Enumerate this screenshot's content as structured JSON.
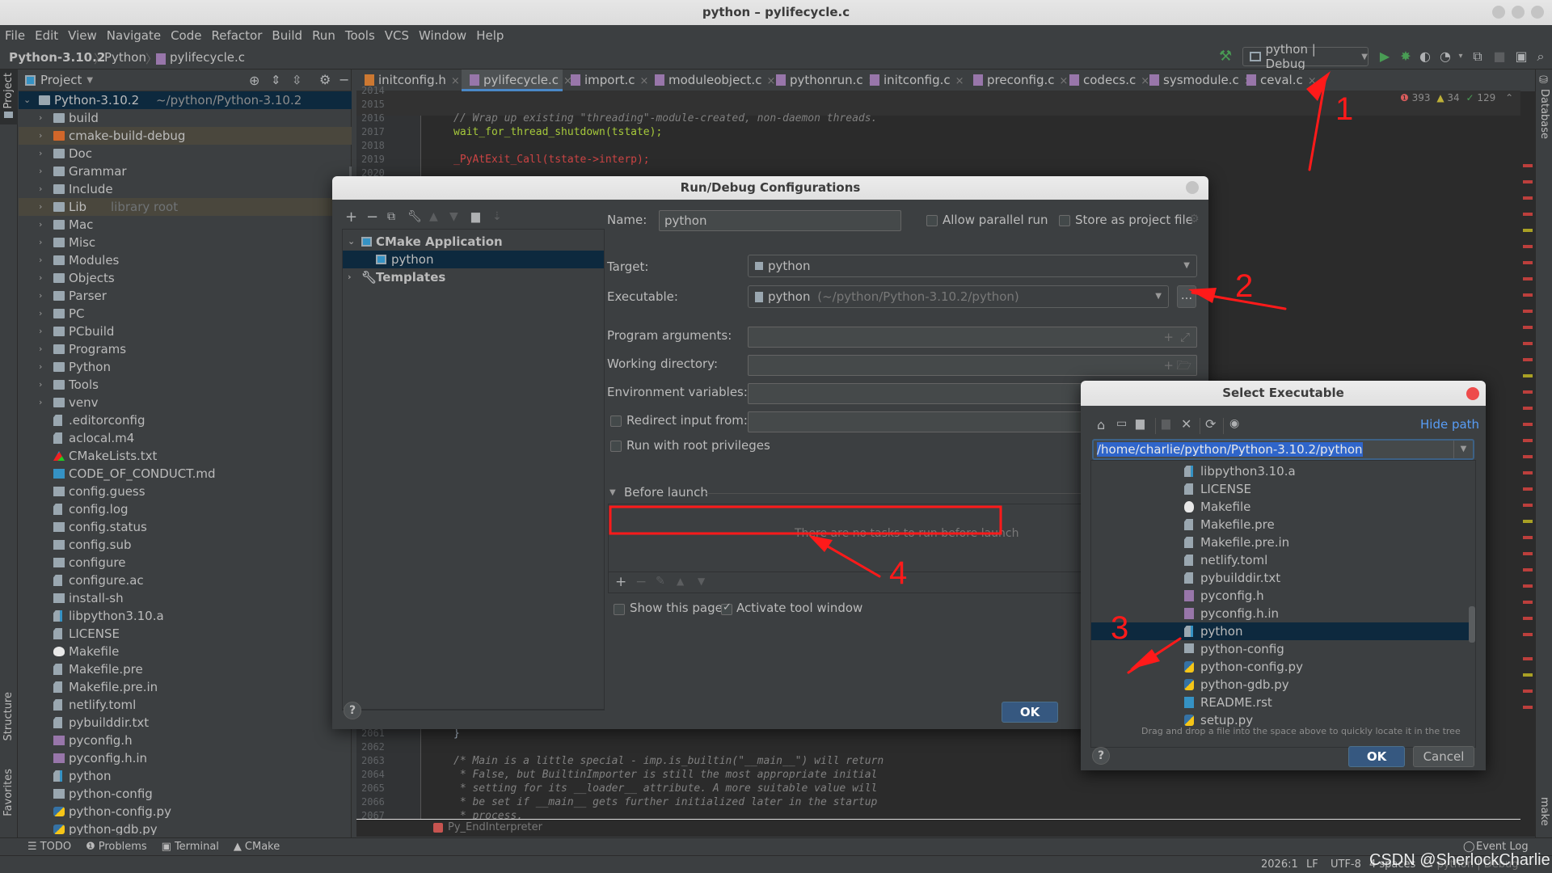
{
  "window": {
    "title": "python – pylifecycle.c"
  },
  "menu": [
    "File",
    "Edit",
    "View",
    "Navigate",
    "Code",
    "Refactor",
    "Build",
    "Run",
    "Tools",
    "VCS",
    "Window",
    "Help"
  ],
  "breadcrumb": [
    "Python-3.10.2",
    "Python",
    "pylifecycle.c"
  ],
  "run_config": {
    "label": "python | Debug"
  },
  "left_stripe": {
    "project": "Project",
    "structure": "Structure",
    "favorites": "Favorites"
  },
  "right_stripe": {
    "database": "Database",
    "make": "make"
  },
  "project_panel": {
    "title": "Project",
    "root": {
      "name": "Python-3.10.2",
      "path": "~/python/Python-3.10.2"
    },
    "items": [
      {
        "name": "build",
        "type": "folder"
      },
      {
        "name": "cmake-build-debug",
        "type": "folder-excluded"
      },
      {
        "name": "Doc",
        "type": "folder"
      },
      {
        "name": "Grammar",
        "type": "folder"
      },
      {
        "name": "Include",
        "type": "folder"
      },
      {
        "name": "Lib",
        "type": "folder",
        "note": "library root"
      },
      {
        "name": "Mac",
        "type": "folder"
      },
      {
        "name": "Misc",
        "type": "folder"
      },
      {
        "name": "Modules",
        "type": "folder"
      },
      {
        "name": "Objects",
        "type": "folder"
      },
      {
        "name": "Parser",
        "type": "folder"
      },
      {
        "name": "PC",
        "type": "folder"
      },
      {
        "name": "PCbuild",
        "type": "folder"
      },
      {
        "name": "Programs",
        "type": "folder"
      },
      {
        "name": "Python",
        "type": "folder"
      },
      {
        "name": "Tools",
        "type": "folder"
      },
      {
        "name": "venv",
        "type": "folder"
      },
      {
        "name": ".editorconfig",
        "type": "file"
      },
      {
        "name": "aclocal.m4",
        "type": "file"
      },
      {
        "name": "CMakeLists.txt",
        "type": "cmake"
      },
      {
        "name": "CODE_OF_CONDUCT.md",
        "type": "md"
      },
      {
        "name": "config.guess",
        "type": "exec"
      },
      {
        "name": "config.log",
        "type": "file"
      },
      {
        "name": "config.status",
        "type": "exec"
      },
      {
        "name": "config.sub",
        "type": "exec"
      },
      {
        "name": "configure",
        "type": "exec"
      },
      {
        "name": "configure.ac",
        "type": "file"
      },
      {
        "name": "install-sh",
        "type": "exec"
      },
      {
        "name": "libpython3.10.a",
        "type": "unknown"
      },
      {
        "name": "LICENSE",
        "type": "file"
      },
      {
        "name": "Makefile",
        "type": "gnu"
      },
      {
        "name": "Makefile.pre",
        "type": "file"
      },
      {
        "name": "Makefile.pre.in",
        "type": "file"
      },
      {
        "name": "netlify.toml",
        "type": "file"
      },
      {
        "name": "pybuilddir.txt",
        "type": "file"
      },
      {
        "name": "pyconfig.h",
        "type": "cpp"
      },
      {
        "name": "pyconfig.h.in",
        "type": "cpp"
      },
      {
        "name": "python",
        "type": "unknown"
      },
      {
        "name": "python-config",
        "type": "exec"
      },
      {
        "name": "python-config.py",
        "type": "py"
      },
      {
        "name": "python-gdb.py",
        "type": "py"
      }
    ]
  },
  "tabs": [
    {
      "label": "initconfig.h",
      "kind": "h"
    },
    {
      "label": "pylifecycle.c",
      "kind": "c",
      "active": true
    },
    {
      "label": "import.c",
      "kind": "c"
    },
    {
      "label": "moduleobject.c",
      "kind": "c"
    },
    {
      "label": "pythonrun.c",
      "kind": "c"
    },
    {
      "label": "initconfig.c",
      "kind": "c"
    },
    {
      "label": "preconfig.c",
      "kind": "c"
    },
    {
      "label": "codecs.c",
      "kind": "c"
    },
    {
      "label": "sysmodule.c",
      "kind": "c"
    },
    {
      "label": "ceval.c",
      "kind": "c"
    }
  ],
  "inspections": {
    "errors": "393",
    "warnings": "34",
    "weak": "129"
  },
  "editor": {
    "top_lines": [
      {
        "n": "2014",
        "code": ""
      },
      {
        "n": "2015",
        "code": ""
      },
      {
        "n": "2016",
        "code": "// Wrap up existing \"threading\"-module-created, non-daemon threads."
      },
      {
        "n": "2017",
        "code": "wait_for_thread_shutdown(tstate);"
      },
      {
        "n": "2018",
        "code": ""
      },
      {
        "n": "2019",
        "code": "_PyAtExit_Call(tstate->interp);"
      },
      {
        "n": "2020",
        "code": ""
      }
    ],
    "bottom_lines": [
      {
        "n": "2061",
        "code": "}"
      },
      {
        "n": "2062",
        "code": ""
      },
      {
        "n": "2063",
        "code": "/* Main is a little special - imp.is_builtin(\"__main__\") will return"
      },
      {
        "n": "2064",
        "code": " * False, but BuiltinImporter is still the most appropriate initial"
      },
      {
        "n": "2065",
        "code": " * setting for its __loader__ attribute. A more suitable value will"
      },
      {
        "n": "2066",
        "code": " * be set if __main__ gets further initialized later in the startup"
      },
      {
        "n": "2067",
        "code": " * process."
      }
    ],
    "breadcrumb_fn": "Py_EndInterpreter"
  },
  "run_debug_dialog": {
    "title": "Run/Debug Configurations",
    "tree": {
      "group": "CMake Application",
      "config": "python",
      "templates": "Templates"
    },
    "name_label": "Name:",
    "name_value": "python",
    "allow_parallel": "Allow parallel run",
    "store_project": "Store as project file",
    "target_label": "Target:",
    "target_value": "python",
    "executable_label": "Executable:",
    "executable_value": "python",
    "executable_path": "(~/python/Python-3.10.2/python)",
    "browse": "...",
    "program_args_label": "Program arguments:",
    "working_dir_label": "Working directory:",
    "env_vars_label": "Environment variables:",
    "redirect_label": "Redirect input from:",
    "root_priv_label": "Run with root privileges",
    "before_launch_label": "Before launch",
    "before_launch_empty": "There are no tasks to run before launch",
    "show_page": "Show this page",
    "activate_tool": "Activate tool window",
    "ok": "OK",
    "help": "?"
  },
  "select_exec_dialog": {
    "title": "Select Executable",
    "hide_path": "Hide path",
    "path_value": "/home/charlie/python/Python-3.10.2/python",
    "items": [
      {
        "name": "libpython3.10.a",
        "type": "unknown"
      },
      {
        "name": "LICENSE",
        "type": "file"
      },
      {
        "name": "Makefile",
        "type": "gnu"
      },
      {
        "name": "Makefile.pre",
        "type": "file"
      },
      {
        "name": "Makefile.pre.in",
        "type": "file"
      },
      {
        "name": "netlify.toml",
        "type": "file"
      },
      {
        "name": "pybuilddir.txt",
        "type": "file"
      },
      {
        "name": "pyconfig.h",
        "type": "cpp"
      },
      {
        "name": "pyconfig.h.in",
        "type": "cpp"
      },
      {
        "name": "python",
        "type": "unknown",
        "selected": true
      },
      {
        "name": "python-config",
        "type": "exec"
      },
      {
        "name": "python-config.py",
        "type": "py"
      },
      {
        "name": "python-gdb.py",
        "type": "py"
      },
      {
        "name": "README.rst",
        "type": "rst"
      },
      {
        "name": "setup.py",
        "type": "py"
      }
    ],
    "hint": "Drag and drop a file into the space above to quickly locate it in the tree",
    "ok": "OK",
    "cancel": "Cancel",
    "help": "?"
  },
  "tool_windows": [
    "TODO",
    "Problems",
    "Terminal",
    "CMake"
  ],
  "event_log": "Event Log",
  "status": {
    "position": "2026:1",
    "line_sep": "LF",
    "encoding": "UTF-8",
    "indent": "4 spaces",
    "context": "C: python | Debug"
  },
  "watermark": "CSDN @SherlockCharlie",
  "annotations": [
    "1",
    "2",
    "3",
    "4"
  ]
}
